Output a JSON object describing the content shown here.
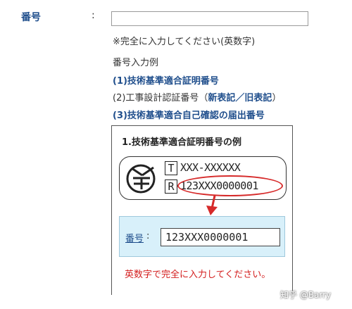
{
  "form": {
    "field_label": "番号",
    "colon": ":",
    "input_value": "",
    "note": "※完全に入力してください(英数字)",
    "examples_title": "番号入力例",
    "example1": "(1)技術基準適合証明番号",
    "example2_prefix": "(2)工事設計認証番号（",
    "example2_link": "新表記／旧表記",
    "example2_suffix": "）",
    "example3": "(3)技術基準適合自己確認の届出番号"
  },
  "example_panel": {
    "title": "1.技術基準適合証明番号の例",
    "mark_letter_top": "T",
    "mark_code_top": "XXX-XXXXXX",
    "mark_letter_bottom": "R",
    "mark_code_bottom": "123XXX0000001",
    "input_label": "番号",
    "input_colon": ":",
    "input_value": "123XXX0000001",
    "warning": "英数字で完全に入力してください。"
  },
  "watermark": "知乎 @Barry",
  "colors": {
    "label_blue": "#1f4e8c",
    "warning_red": "#d42020",
    "highlight_red": "#d62a2a",
    "input_box_bg": "#d8f0fa"
  },
  "icons": [
    "giteki-mark-icon",
    "arrow-down-icon"
  ]
}
